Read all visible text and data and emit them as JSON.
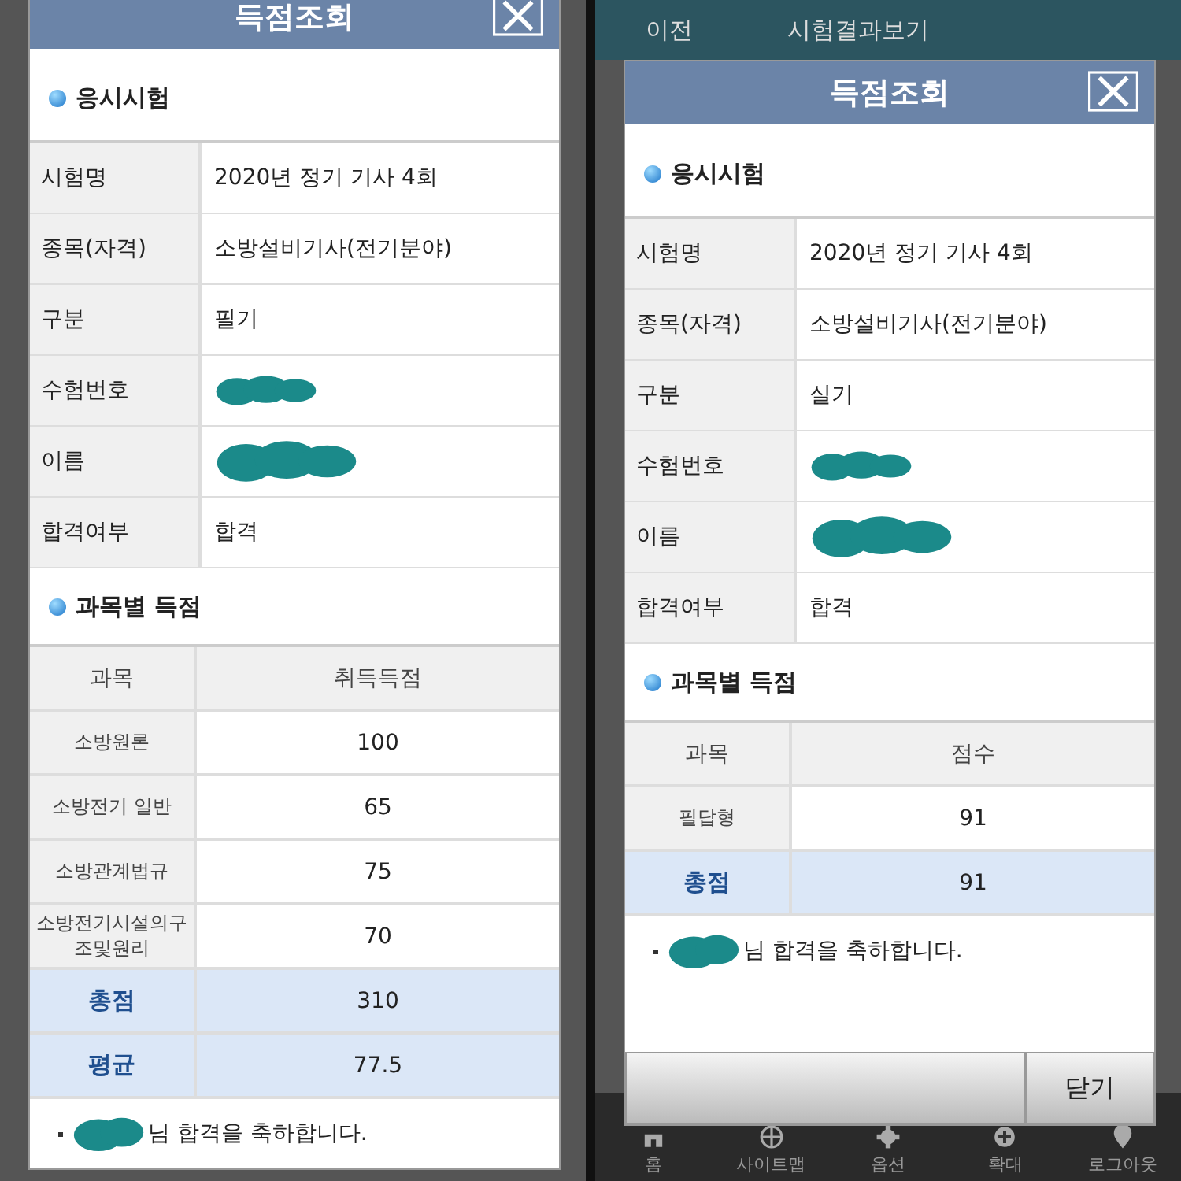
{
  "panels": [
    {
      "dialog": {
        "title": "득점조회",
        "info_heading": "응시시험",
        "info_rows": [
          {
            "label": "시험명",
            "value": "2020년 정기 기사 4회",
            "redacted": false
          },
          {
            "label": "종목(자격)",
            "value": "소방설비기사(전기분야)",
            "redacted": false
          },
          {
            "label": "구분",
            "value": "필기",
            "redacted": false
          },
          {
            "label": "수험번호",
            "redacted": true
          },
          {
            "label": "이름",
            "redacted": true
          },
          {
            "label": "합격여부",
            "value": "합격",
            "redacted": false
          }
        ],
        "score_heading": "과목별 득점",
        "score_columns": [
          "과목",
          "취득득점"
        ],
        "score_rows": [
          {
            "kind": "subject",
            "subject": "소방원론",
            "score": "100"
          },
          {
            "kind": "subject",
            "subject": "소방전기 일반",
            "score": "65"
          },
          {
            "kind": "subject",
            "subject": "소방관계법규",
            "score": "75"
          },
          {
            "kind": "subject",
            "subject": "소방전기시설의구조및원리",
            "score": "70"
          },
          {
            "kind": "total",
            "subject": "총점",
            "score": "310"
          },
          {
            "kind": "total",
            "subject": "평균",
            "score": "77.5"
          }
        ],
        "message": "님 합격을 축하합니다."
      }
    },
    {
      "app_bar": {
        "back": "이전",
        "title": "시험결과보기"
      },
      "dialog": {
        "title": "득점조회",
        "info_heading": "응시시험",
        "info_rows": [
          {
            "label": "시험명",
            "value": "2020년 정기 기사 4회",
            "redacted": false
          },
          {
            "label": "종목(자격)",
            "value": "소방설비기사(전기분야)",
            "redacted": false
          },
          {
            "label": "구분",
            "value": "실기",
            "redacted": false
          },
          {
            "label": "수험번호",
            "redacted": true
          },
          {
            "label": "이름",
            "redacted": true
          },
          {
            "label": "합격여부",
            "value": "합격",
            "redacted": false
          }
        ],
        "score_heading": "과목별 득점",
        "score_columns": [
          "과목",
          "점수"
        ],
        "score_rows": [
          {
            "kind": "subject",
            "subject": "필답형",
            "score": "91"
          },
          {
            "kind": "total",
            "subject": "총점",
            "score": "91"
          }
        ],
        "message": "님 합격을 축하합니다.",
        "footer_button": "닫기"
      },
      "bottom_nav": [
        {
          "kind": "home",
          "label": "홈"
        },
        {
          "kind": "globe",
          "label": "사이트맵"
        },
        {
          "kind": "gear",
          "label": "옵션"
        },
        {
          "kind": "plus",
          "label": "확대"
        },
        {
          "kind": "logout",
          "label": "로그아웃"
        }
      ]
    }
  ]
}
